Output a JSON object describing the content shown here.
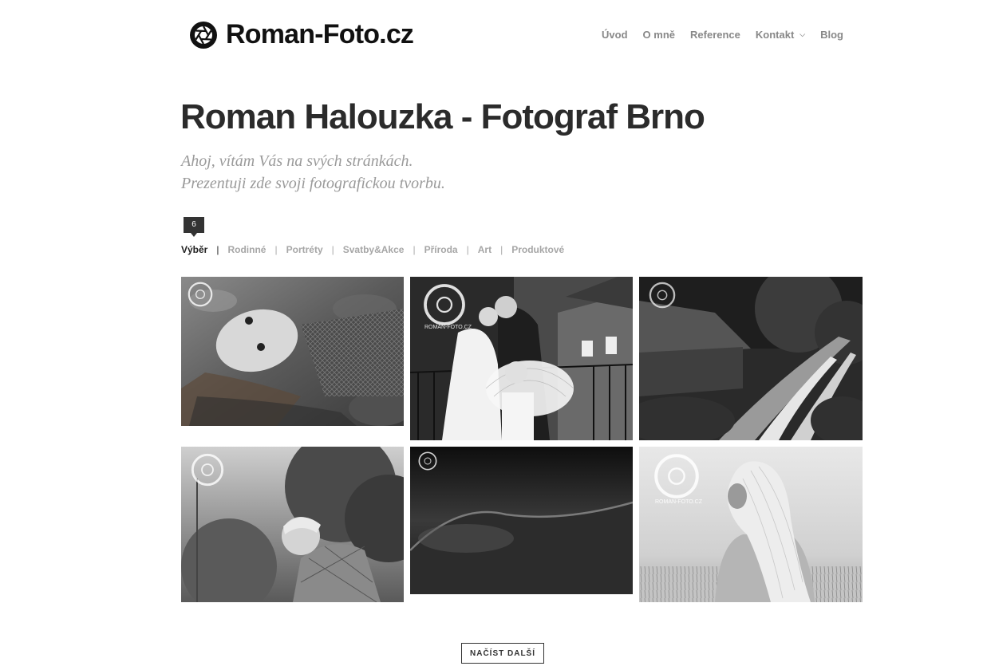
{
  "brand": {
    "name": "Roman-Foto.cz",
    "logo_icon": "aperture-icon"
  },
  "nav": {
    "items": [
      {
        "label": "Úvod"
      },
      {
        "label": "O mně"
      },
      {
        "label": "Reference"
      },
      {
        "label": "Kontakt",
        "has_dropdown": true,
        "icon": "chevron-down-icon"
      },
      {
        "label": "Blog"
      }
    ]
  },
  "hero": {
    "title": "Roman Halouzka - Fotograf Brno",
    "subtitle_line1": "Ahoj, vítám Vás na svých stránkách.",
    "subtitle_line2": "Prezentuji zde svoji fotografickou tvorbu."
  },
  "filter": {
    "count": "6",
    "items": [
      {
        "label": "Výběr",
        "active": true
      },
      {
        "label": "Rodinné"
      },
      {
        "label": "Portréty"
      },
      {
        "label": "Svatby&Akce"
      },
      {
        "label": "Příroda"
      },
      {
        "label": "Art"
      },
      {
        "label": "Produktové"
      }
    ],
    "separator": "|"
  },
  "gallery": {
    "watermark_text": "ROMAN-FOTO.CZ",
    "photos": [
      {
        "subject": "woman lying in autumn leaves",
        "style": "black-and-white"
      },
      {
        "subject": "wedding couple kissing with girl holding lace umbrella",
        "style": "black-and-white"
      },
      {
        "subject": "country cottage and dirt road",
        "style": "black-and-white"
      },
      {
        "subject": "young boy in plaid shirt",
        "style": "black-and-white"
      },
      {
        "subject": "abstract close-up landscape",
        "style": "black-and-white"
      },
      {
        "subject": "blonde woman in wheat field",
        "style": "black-and-white"
      }
    ]
  },
  "load_more": {
    "label": "NAČÍST DALŠÍ"
  },
  "colors": {
    "text_dark": "#2b2b2b",
    "text_muted": "#888888",
    "badge_bg": "#333333",
    "background": "#ffffff"
  }
}
